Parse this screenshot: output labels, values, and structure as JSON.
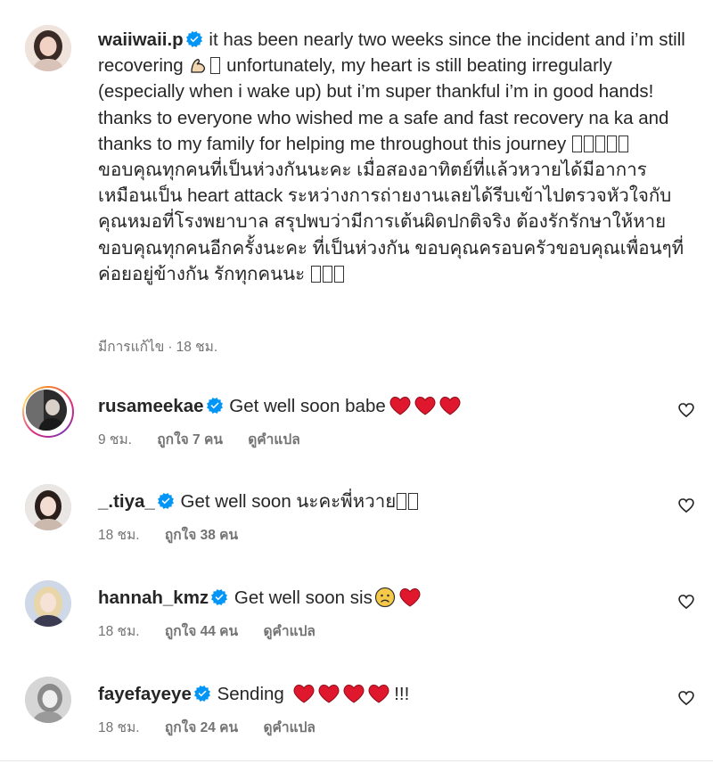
{
  "caption": {
    "username": "waiiwaii.p",
    "text_part1": " it has been nearly two weeks since the incident and i’m still recovering ",
    "text_part2": " unfortunately, my heart is still beating irregularly (especially when i wake up) but i’m super thankful i’m in good hands! thanks to everyone who wished me a safe and fast recovery na ka and thanks to my family for helping me throughout this journey ",
    "text_part3": " ขอบคุณทุกคนที่เป็นห่วงกันนะคะ เมื่อสองอาทิตย์ที่แล้วหวายได้มีอาการเหมือนเป็น heart attack ระหว่างการถ่ายงานเลยได้รีบเข้าไปตรวจหัวใจกับคุณหมอที่โรงพยาบาล สรุปพบว่ามีการเต้นผิดปกติจริง ต้องรักรักษาให้หาย ขอบคุณทุกคนอีกครั้งนะคะ ที่เป็นห่วงกัน ขอบคุณครอบครัวขอบคุณเพื่อนๆที่ค่อยอยู่ข้างกัน รักทุกคนนะ ",
    "edited_label": "มีการแก้ไข",
    "dot": "·",
    "time": "18 ชม."
  },
  "comments": [
    {
      "username": "rusameekae",
      "text": " Get well soon babe",
      "time": "9 ชม.",
      "likes": "ถูกใจ 7 คน",
      "translate": "ดูคำแปล"
    },
    {
      "username": "_.tiya_",
      "text": " Get well soon นะคะพี่หวาย",
      "time": "18 ชม.",
      "likes": "ถูกใจ 38 คน",
      "translate": ""
    },
    {
      "username": "hannah_kmz",
      "text": " Get well soon sis",
      "time": "18 ชม.",
      "likes": "ถูกใจ 44 คน",
      "translate": "ดูคำแปล"
    },
    {
      "username": "fayefayeye",
      "text": " Sending ",
      "text_after": " !!!",
      "time": "18 ชม.",
      "likes": "ถูกใจ 24 คน",
      "translate": "ดูคำแปล"
    }
  ],
  "icons": {
    "verified": "verified-badge-icon",
    "like": "heart-outline-icon"
  },
  "colors": {
    "verified_blue": "#0095f6",
    "heart_red": "#e0182d",
    "meta_gray": "#737373"
  }
}
